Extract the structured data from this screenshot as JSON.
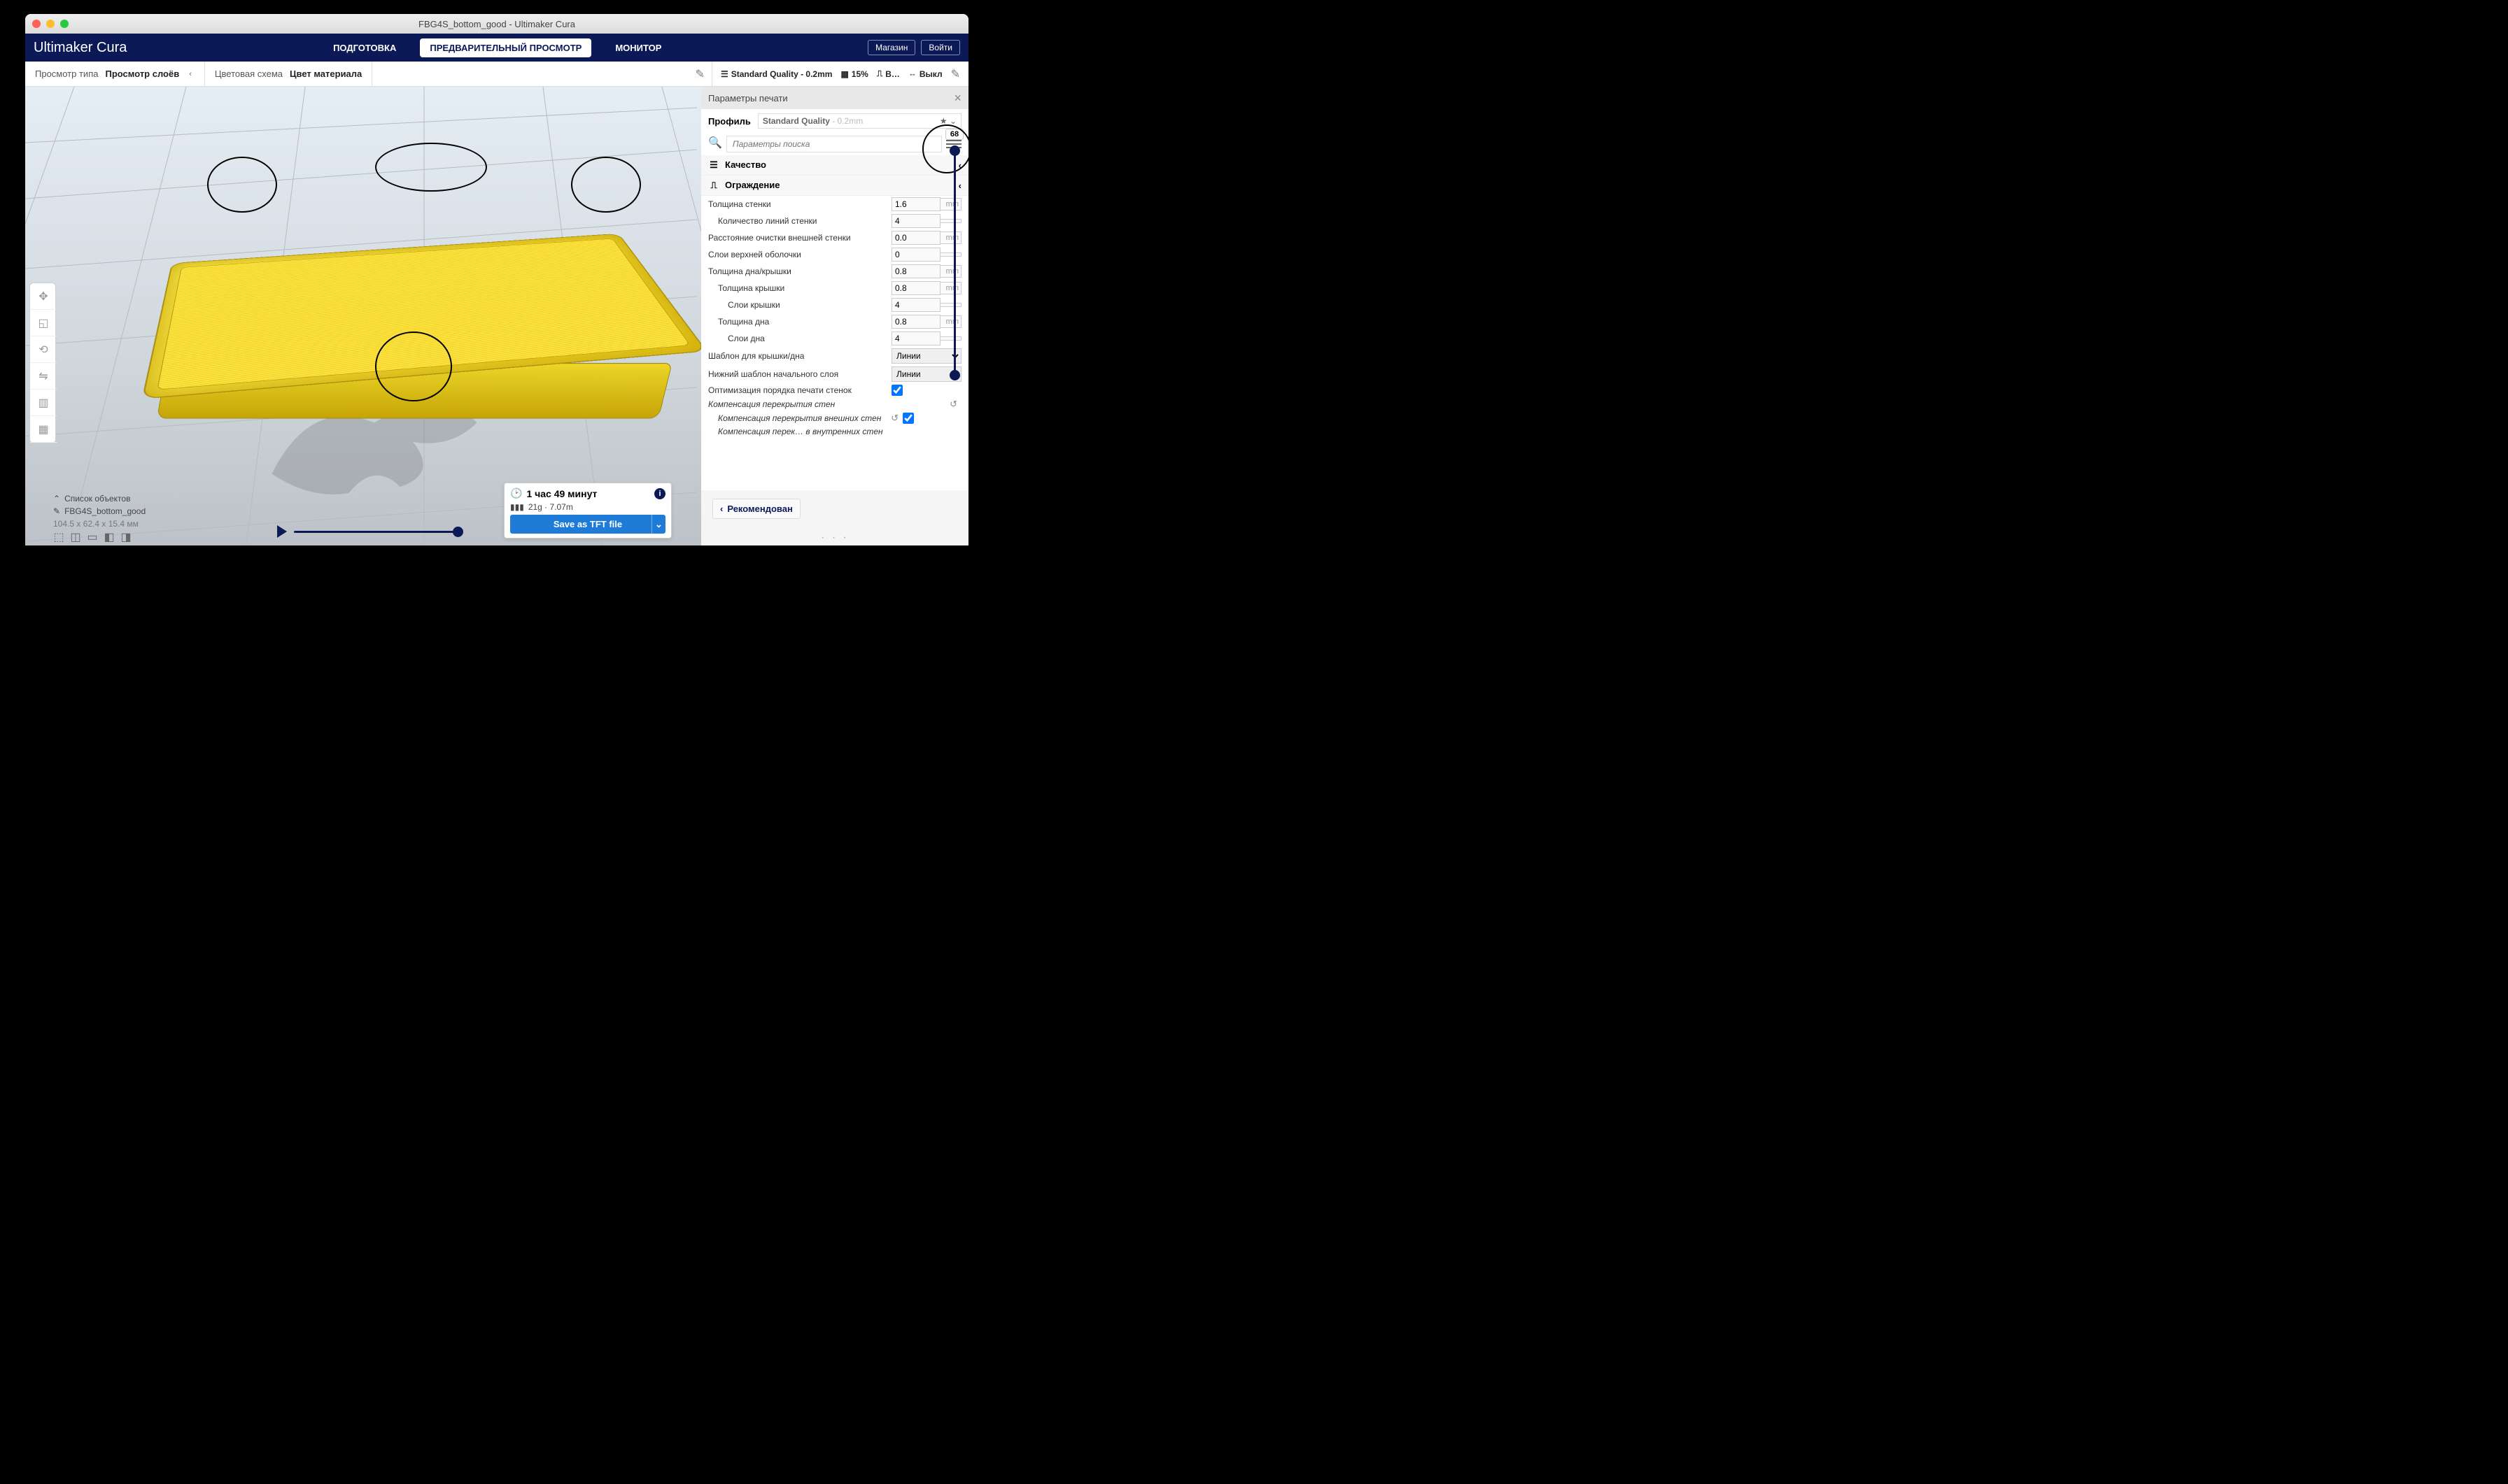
{
  "title": "FBG4S_bottom_good - Ultimaker Cura",
  "logo": {
    "main": "Ultimaker",
    "sub": "Cura"
  },
  "topTabs": {
    "prepare": "ПОДГОТОВКА",
    "preview": "ПРЕДВАРИТЕЛЬНЫЙ ПРОСМОТР",
    "monitor": "МОНИТОР"
  },
  "topButtons": {
    "store": "Магазин",
    "login": "Войти"
  },
  "viewBar": {
    "left": {
      "label": "Просмотр типа",
      "value": "Просмотр слоёв"
    },
    "scheme": {
      "label": "Цветовая схема",
      "value": "Цвет материала"
    },
    "quality": "Standard Quality - 0.2mm",
    "infill": "15%",
    "support": "В…",
    "adhesion": "Выкл"
  },
  "layerSlider": {
    "value": "68"
  },
  "panel": {
    "title": "Параметры печати",
    "profileLabel": "Профиль",
    "profileValue": "Standard Quality",
    "profileDetail": "- 0.2mm",
    "searchPlaceholder": "Параметры поиска",
    "sections": {
      "quality": "Качество",
      "walls": "Ограждение"
    },
    "settings": [
      {
        "name": "Толщина стенки",
        "value": "1.6",
        "unit": "mm",
        "ind": 0,
        "type": "num"
      },
      {
        "name": "Количество линий стенки",
        "value": "4",
        "unit": "",
        "ind": 1,
        "type": "num"
      },
      {
        "name": "Расстояние очистки внешней стенки",
        "value": "0.0",
        "unit": "mm",
        "ind": 0,
        "type": "num"
      },
      {
        "name": "Слои верхней оболочки",
        "value": "0",
        "unit": "",
        "ind": 0,
        "type": "num"
      },
      {
        "name": "Толщина дна/крышки",
        "value": "0.8",
        "unit": "mm",
        "ind": 0,
        "type": "num"
      },
      {
        "name": "Толщина крышки",
        "value": "0.8",
        "unit": "mm",
        "ind": 1,
        "type": "num"
      },
      {
        "name": "Слои крышки",
        "value": "4",
        "unit": "",
        "ind": 2,
        "type": "num"
      },
      {
        "name": "Толщина дна",
        "value": "0.8",
        "unit": "mm",
        "ind": 1,
        "type": "num"
      },
      {
        "name": "Слои дна",
        "value": "4",
        "unit": "",
        "ind": 2,
        "type": "num"
      },
      {
        "name": "Шаблон для крышки/дна",
        "value": "Линии",
        "unit": "",
        "ind": 0,
        "type": "sel"
      },
      {
        "name": "Нижний шаблон начального слоя",
        "value": "Линии",
        "unit": "",
        "ind": 0,
        "type": "sel"
      },
      {
        "name": "Оптимизация порядка печати стенок",
        "value": "true",
        "unit": "",
        "ind": 0,
        "type": "chk"
      },
      {
        "name": "Компенсация перекрытия стен",
        "value": "",
        "unit": "",
        "ind": 0,
        "type": "reset",
        "italic": true
      },
      {
        "name": "Компенсация перекрытия внешних стен",
        "value": "true",
        "unit": "",
        "ind": 1,
        "type": "chk-reset",
        "italic": true
      },
      {
        "name": "Компенсация перек… в внутренних стен",
        "value": "",
        "unit": "",
        "ind": 1,
        "type": "none",
        "italic": true
      }
    ],
    "recommend": "Рекомендован"
  },
  "objectList": {
    "header": "Список объектов",
    "item": "FBG4S_bottom_good",
    "dims": "104.5 x 62.4 x 15.4 мм"
  },
  "info": {
    "time": "1 час 49 минут",
    "material": "21g · 7.07m",
    "save": "Save as TFT file"
  }
}
